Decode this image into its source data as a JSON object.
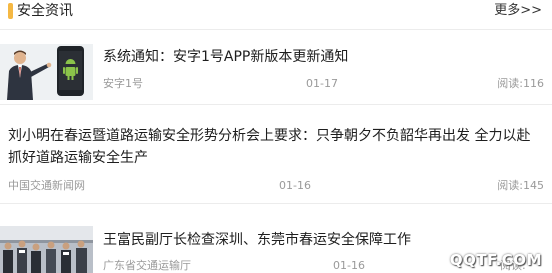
{
  "section": {
    "title": "安全资讯",
    "more_label": "更多>>",
    "accent_color": "#f5b843"
  },
  "articles": [
    {
      "title": "系统通知：安字1号APP新版本更新通知",
      "source": "安字1号",
      "date": "01-17",
      "reads": "阅读:116",
      "thumbnail": "android-presenter-image"
    },
    {
      "title_line1": "刘小明在春运暨道路运输安全形势分析会上要求：只争朝夕不负韶华再出发 全力以赴",
      "title_line2": "抓好道路运输安全生产",
      "source": "中国交通新闻网",
      "date": "01-16",
      "reads": "阅读:145"
    },
    {
      "title": "王富民副厅长检查深圳、东莞市春运安全保障工作",
      "source": "广东省交通运输厅",
      "date": "01-16",
      "reads": "阅读:"
    }
  ],
  "watermark": "QQTF.COM"
}
